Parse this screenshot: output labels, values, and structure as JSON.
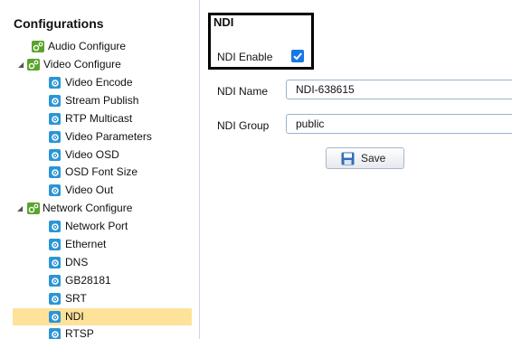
{
  "sidebar": {
    "title": "Configurations",
    "items": [
      {
        "label": "Audio Configure",
        "icon": "folder-config-icon"
      },
      {
        "label": "Video Configure",
        "icon": "folder-config-icon",
        "expanded": true
      },
      {
        "label": "Video Encode",
        "icon": "gear-icon"
      },
      {
        "label": "Stream Publish",
        "icon": "gear-icon"
      },
      {
        "label": "RTP Multicast",
        "icon": "gear-icon"
      },
      {
        "label": "Video Parameters",
        "icon": "gear-icon"
      },
      {
        "label": "Video OSD",
        "icon": "gear-icon"
      },
      {
        "label": "OSD Font Size",
        "icon": "gear-icon"
      },
      {
        "label": "Video Out",
        "icon": "gear-icon"
      },
      {
        "label": "Network Configure",
        "icon": "folder-config-icon",
        "expanded": true
      },
      {
        "label": "Network Port",
        "icon": "gear-icon"
      },
      {
        "label": "Ethernet",
        "icon": "gear-icon"
      },
      {
        "label": "DNS",
        "icon": "gear-icon"
      },
      {
        "label": "GB28181",
        "icon": "gear-icon"
      },
      {
        "label": "SRT",
        "icon": "gear-icon"
      },
      {
        "label": "NDI",
        "icon": "gear-icon",
        "selected": true
      },
      {
        "label": "RTSP",
        "icon": "gear-icon"
      }
    ]
  },
  "main": {
    "title": "NDI",
    "ndi_enable": {
      "label": "NDI Enable",
      "checked": true
    },
    "ndi_name": {
      "label": "NDI Name",
      "value": "NDI-638615"
    },
    "ndi_group": {
      "label": "NDI Group",
      "value": "public"
    },
    "save_label": "Save"
  },
  "colors": {
    "selected_row": "#fde39a",
    "gear_icon": "#2b95d6",
    "folder_icon": "#58a42c",
    "checkbox": "#1677e5"
  }
}
